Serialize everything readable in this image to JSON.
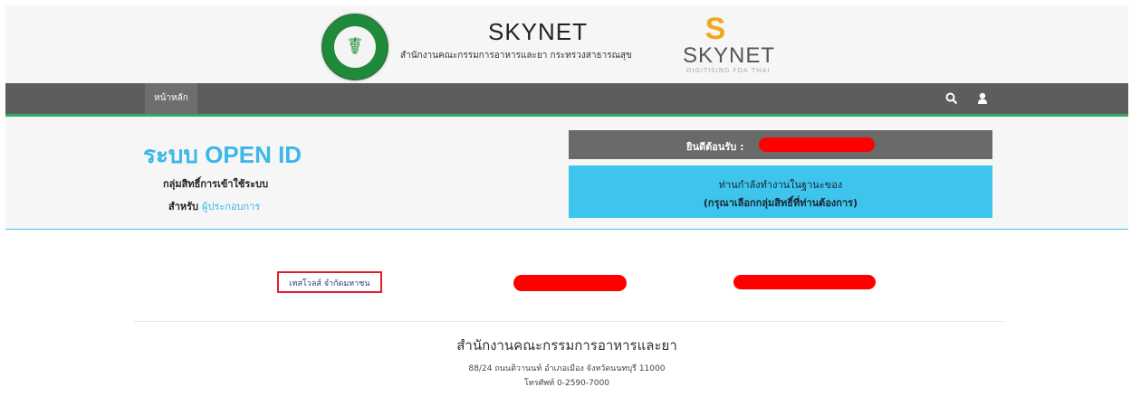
{
  "header": {
    "seal_icon": "ministry-seal-icon",
    "title": "SKYNET",
    "subtitle": "สำนักงานคณะกรรมการอาหารและยา กระทรวงสาธารณสุข",
    "logo_glyph": "S",
    "logo_name": "SKYNET",
    "logo_tagline": "DIGITISING FDA THAI",
    "logo_color": "#f0a81c"
  },
  "navbar": {
    "home_label": "หน้าหลัก",
    "search_icon": "🔍",
    "user_icon": "👤",
    "bg_color": "#5d5d5d",
    "accent_color": "#2faa63"
  },
  "openid": {
    "title": "ระบบ OPEN ID",
    "group_label": "กลุ่มสิทธิ์การเข้าใช้ระบบ",
    "for_prefix": "สำหรับ",
    "for_role": "ผู้ประกอบการ",
    "accent_color": "#3bb8e8"
  },
  "welcome": {
    "label": "ยินดีต้อนรับ :"
  },
  "info": {
    "line1": "ท่านกำลังทำงานในฐานะของ",
    "line2": "(กรุณาเลือกกลุ่มสิทธิ์ที่ท่านต้องการ)",
    "bg_color": "#3ec5ee"
  },
  "companies": {
    "selected_label": "เทสโวลส์ จำกัดมหาชน"
  },
  "footer": {
    "org_name": "สำนักงานคณะกรรมการอาหารและยา",
    "address": "88/24 ถนนติวานนท์ อำเภอเมือง จังหวัดนนทบุรี 11000",
    "phone": "โทรศัพท์ 0-2590-7000"
  }
}
